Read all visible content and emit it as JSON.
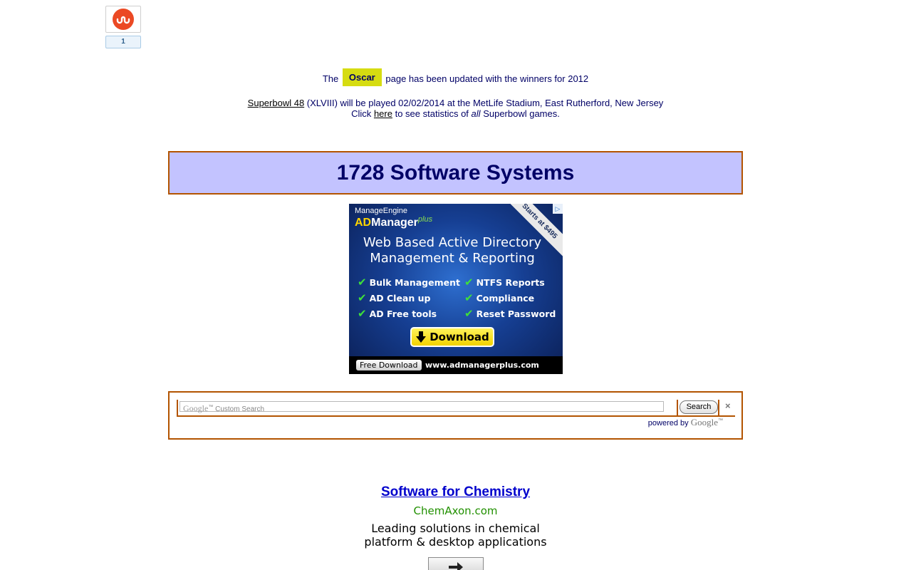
{
  "stumbleupon": {
    "icon": "stumbleupon-icon",
    "count": "1"
  },
  "oscar_notice": {
    "prefix": "The",
    "badge": "Oscar",
    "suffix": "page has been updated with the winners for 2012"
  },
  "superbowl_notice": {
    "link_text": "Superbowl 48",
    "line1_rest": "(XLVIII) will be played 02/02/2014 at the MetLife Stadium, East Rutherford, New Jersey",
    "line2_prefix": "Click",
    "here_link": "here",
    "line2_mid": "to see statistics of",
    "line2_em": "all",
    "line2_suffix": "Superbowl games."
  },
  "site_title": "1728 Software Systems",
  "ad_banner": {
    "brand_line1": "ManageEngine",
    "brand_ad": "AD",
    "brand_manager": "Manager",
    "brand_plus": "plus",
    "corner_ribbon": "Starts at $495",
    "info_icon": "▷",
    "headline_line1": "Web Based Active Directory",
    "headline_line2": "Management & Reporting",
    "features": [
      "Bulk Management",
      "NTFS Reports",
      "AD Clean up",
      "Compliance",
      "AD Free tools",
      "Reset Password"
    ],
    "download_label": "Download",
    "free_download_label": "Free Download",
    "url": "www.admanagerplus.com"
  },
  "search": {
    "google_mark": "Google",
    "tm": "™",
    "placeholder": "Custom Search",
    "button_label": "Search",
    "clear_label": "×",
    "powered_by": "powered by",
    "powered_google": "Google",
    "powered_tm": "™"
  },
  "chem_ad": {
    "title": "Software for Chemistry",
    "url": "ChemAxon.com",
    "desc_line1": "Leading solutions in chemical",
    "desc_line2": "platform & desktop applications"
  },
  "colors": {
    "title_bg": "#c3c3ff",
    "border": "#b35400",
    "text": "#000066",
    "oscar_badge": "#d6dc11"
  }
}
